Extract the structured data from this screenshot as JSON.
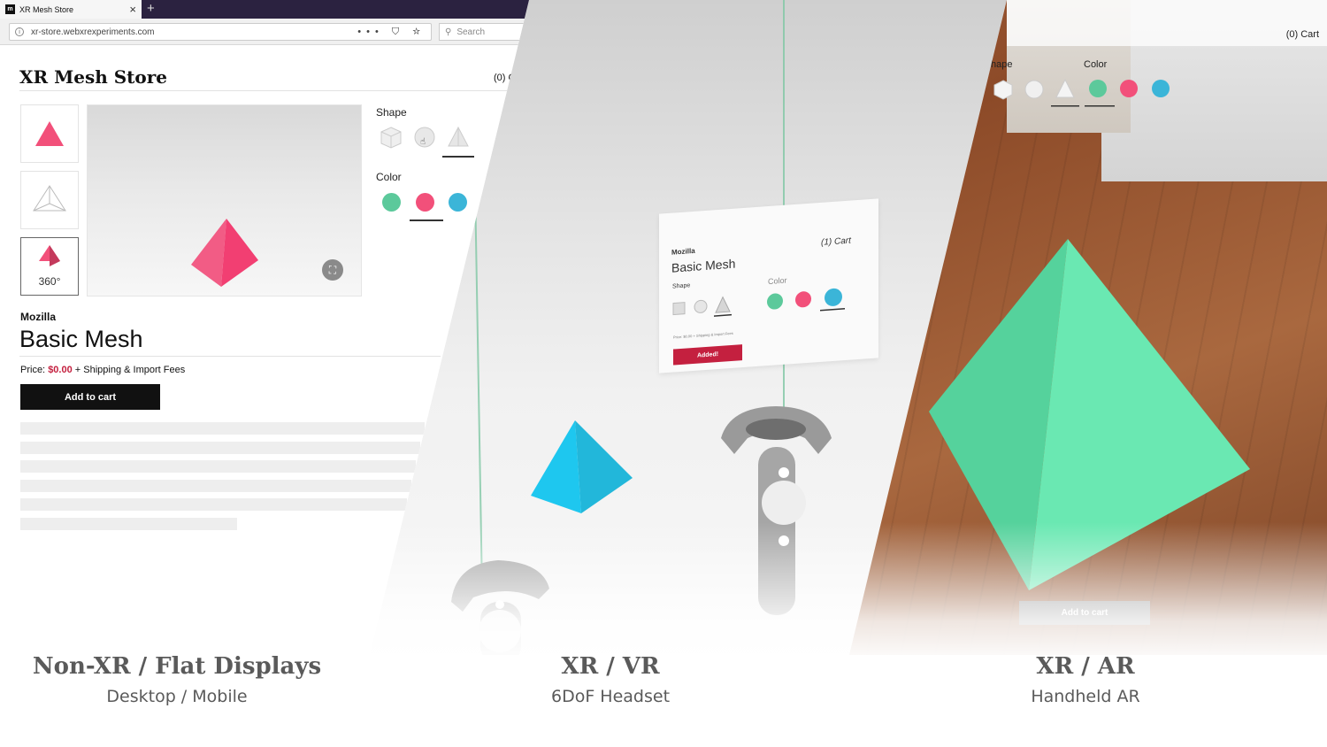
{
  "browser": {
    "tab_title": "XR Mesh Store",
    "favicon_letter": "m",
    "tab_close": "×",
    "new_tab": "+",
    "url": "xr-store.webxrexperiments.com",
    "url_icons": "••• ⛉ ☆",
    "search_placeholder": "Search"
  },
  "store": {
    "title": "XR Mesh Store",
    "cart": "(0) C",
    "shape_label": "Shape",
    "color_label": "Color",
    "brand": "Mozilla",
    "product_name": "Basic Mesh",
    "price_label": "Price:",
    "price_amount": "$0.00",
    "price_suffix": "+ Shipping & Import Fees",
    "add_to_cart": "Add to cart",
    "label_360": "360°",
    "selected_shape": "pyramid",
    "selected_color": "pink"
  },
  "colors": {
    "green": "#5cc99b",
    "pink": "#f2507a",
    "blue": "#3bb5d8",
    "ar_green": "#5de0a7",
    "vr_cyan": "#1ec7ef"
  },
  "vr_card": {
    "brand": "Mozilla",
    "title": "Basic Mesh",
    "cart": "(1) Cart",
    "shape_label": "Shape",
    "color_label": "Color",
    "price_line": "Price: $0.00 + Shipping & Import Fees",
    "button": "Added!"
  },
  "ar": {
    "cart": "(0) Cart",
    "shape_label": "hape",
    "color_label": "Color",
    "add_to_cart": "Add to cart"
  },
  "captions": [
    {
      "title": "Non-XR / Flat Displays",
      "subtitle": "Desktop / Mobile"
    },
    {
      "title": "XR / VR",
      "subtitle": "6DoF Headset"
    },
    {
      "title": "XR / AR",
      "subtitle": "Handheld AR"
    }
  ]
}
